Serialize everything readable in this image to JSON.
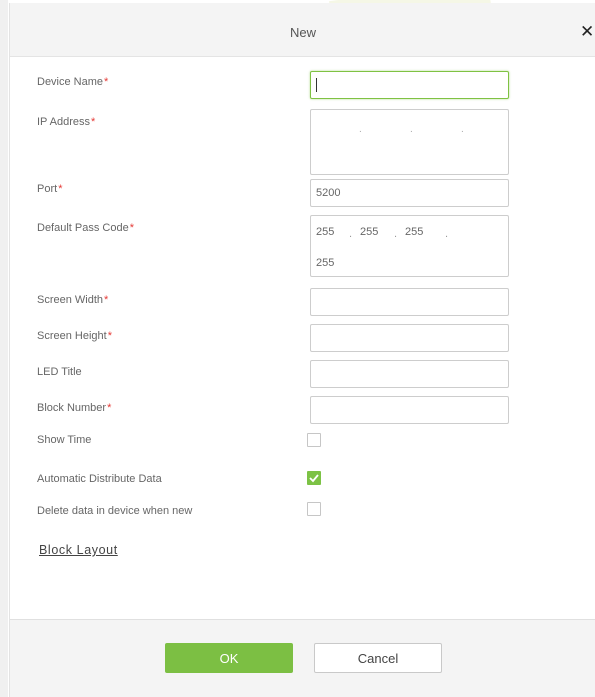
{
  "dialog": {
    "title": "New",
    "close_symbol": "✕"
  },
  "form": {
    "required_mark": "*",
    "device_name": {
      "label": "Device Name",
      "value": ""
    },
    "ip_address": {
      "label": "IP Address",
      "separators": [
        ".",
        ".",
        "."
      ]
    },
    "port": {
      "label": "Port",
      "value": "5200"
    },
    "default_pass_code": {
      "label": "Default Pass Code",
      "segments": [
        "255",
        "255",
        "255",
        "255"
      ],
      "separator": "."
    },
    "screen_width": {
      "label": "Screen Width",
      "value": ""
    },
    "screen_height": {
      "label": "Screen Height",
      "value": ""
    },
    "led_title": {
      "label": "LED Title",
      "value": ""
    },
    "block_number": {
      "label": "Block Number",
      "value": ""
    },
    "show_time": {
      "label": "Show Time",
      "checked": false
    },
    "automatic_distribute_data": {
      "label": "Automatic Distribute Data",
      "checked": true
    },
    "delete_data_when_new": {
      "label": "Delete data in device when new",
      "checked": false
    }
  },
  "links": {
    "block_layout": "Block Layout"
  },
  "footer": {
    "ok_label": "OK",
    "cancel_label": "Cancel"
  },
  "colors": {
    "accent": "#7cbf43",
    "required": "#e53935",
    "header_bg": "#f4f4f4"
  },
  "icons": {
    "close": "close-icon",
    "check": "checkmark-icon"
  }
}
